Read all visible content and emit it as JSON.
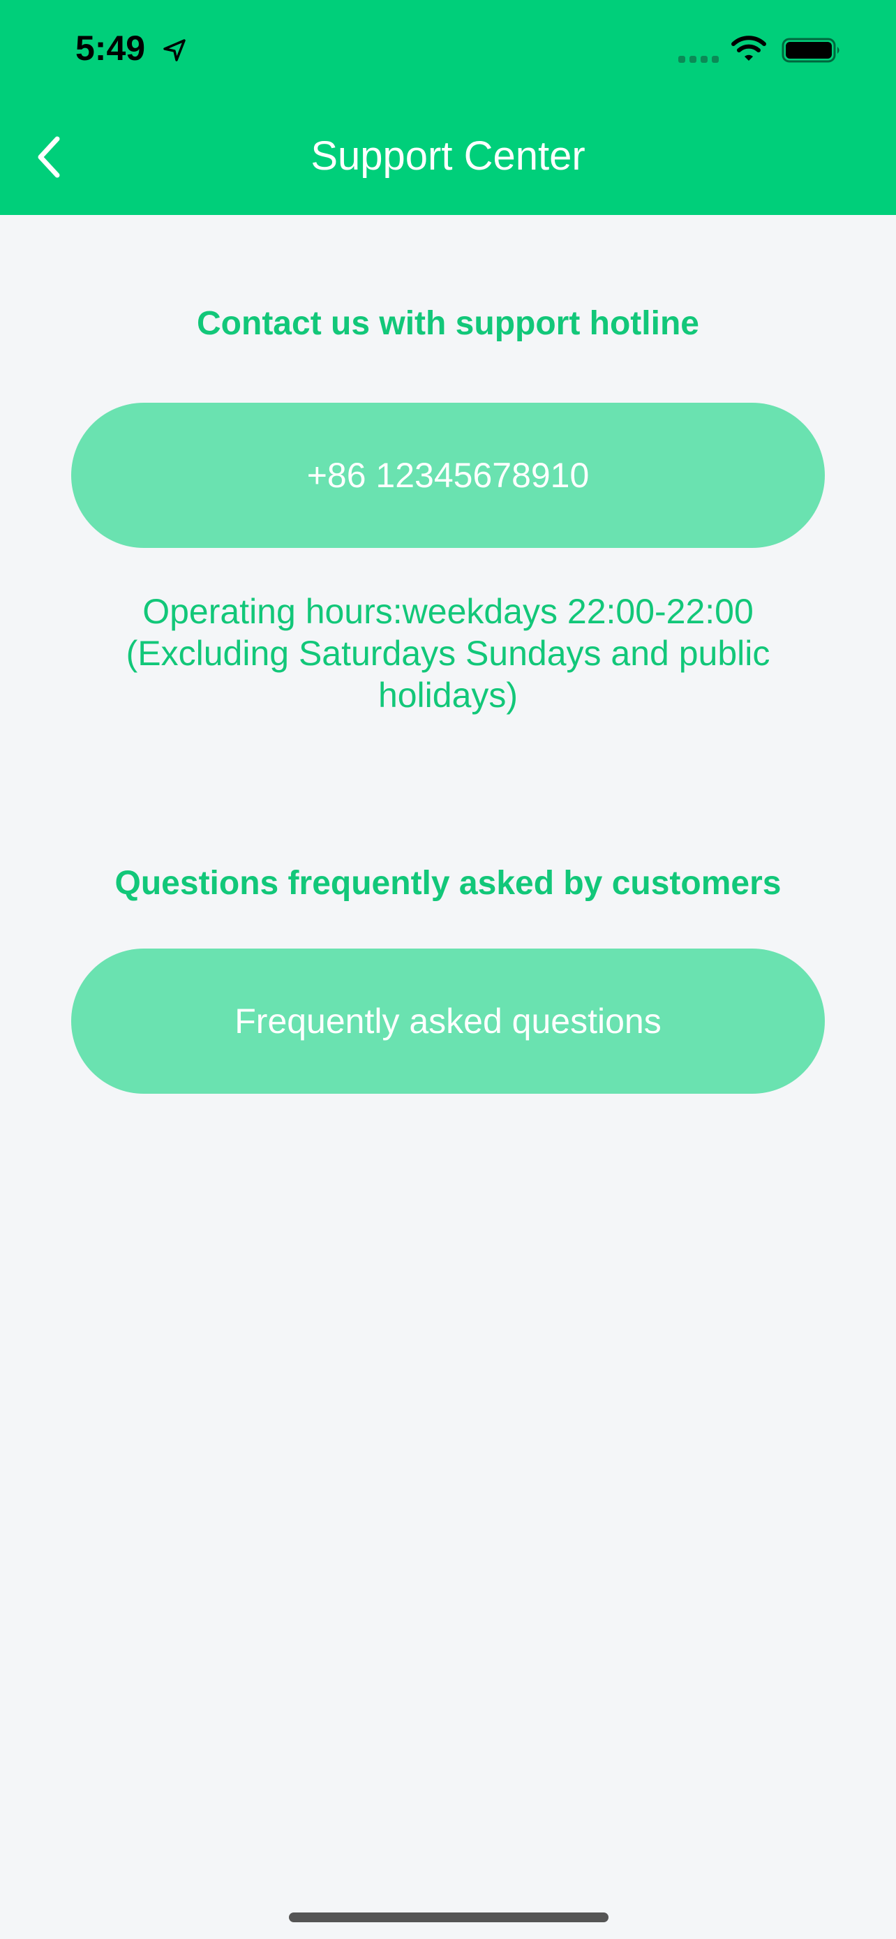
{
  "status_bar": {
    "time": "5:49"
  },
  "nav": {
    "title": "Support Center"
  },
  "hotline": {
    "heading": "Contact us with support hotline",
    "phone_label": "+86 12345678910",
    "hours_line1": "Operating hours:weekdays 22:00-22:00",
    "hours_line2": "(Excluding Saturdays Sundays and public",
    "hours_line3": "holidays)"
  },
  "faq": {
    "heading": "Questions frequently asked by customers",
    "button_label": "Frequently asked questions"
  },
  "colors": {
    "header": "#00cf7a",
    "accent_text": "#12c779",
    "button": "#6ae2b0",
    "background": "#f4f6f8"
  },
  "icons": {
    "back": "chevron-left-icon",
    "location": "location-arrow-icon",
    "signal": "cellular-signal-icon",
    "wifi": "wifi-icon",
    "battery": "battery-icon"
  }
}
